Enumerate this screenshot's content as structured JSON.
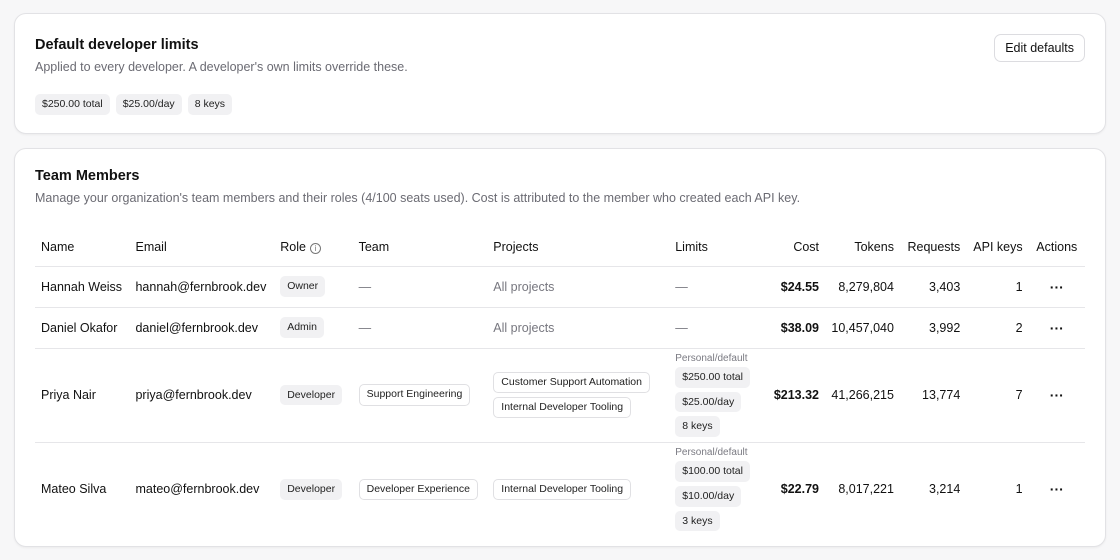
{
  "defaults": {
    "title": "Default developer limits",
    "description": "Applied to every developer. A developer's own limits override these.",
    "edit_label": "Edit defaults",
    "chips": [
      "$250.00 total",
      "$25.00/day",
      "8 keys"
    ]
  },
  "team": {
    "title": "Team Members",
    "description": "Manage your organization's team members and their roles (4/100 seats used). Cost is attributed to the member who created each API key.",
    "columns": {
      "name": "Name",
      "email": "Email",
      "role": "Role",
      "team": "Team",
      "projects": "Projects",
      "limits": "Limits",
      "cost": "Cost",
      "tokens": "Tokens",
      "requests": "Requests",
      "api_keys": "API keys",
      "actions": "Actions"
    },
    "members": [
      {
        "name": "Hannah Weiss",
        "email": "hannah@fernbrook.dev",
        "role": "Owner",
        "team": "—",
        "projects": "All projects",
        "limits": "—",
        "cost": "$24.55",
        "tokens": "8,279,804",
        "requests": "3,403",
        "api_keys": "1"
      },
      {
        "name": "Daniel Okafor",
        "email": "daniel@fernbrook.dev",
        "role": "Admin",
        "team": "—",
        "projects": "All projects",
        "limits": "—",
        "cost": "$38.09",
        "tokens": "10,457,040",
        "requests": "3,992",
        "api_keys": "2"
      },
      {
        "name": "Priya Nair",
        "email": "priya@fernbrook.dev",
        "role": "Developer",
        "team": "Support Engineering",
        "projects": [
          "Customer Support Automation",
          "Internal Developer Tooling"
        ],
        "limits_label": "Personal/default",
        "limits": [
          "$250.00 total",
          "$25.00/day",
          "8 keys"
        ],
        "cost": "$213.32",
        "tokens": "41,266,215",
        "requests": "13,774",
        "api_keys": "7"
      },
      {
        "name": "Mateo Silva",
        "email": "mateo@fernbrook.dev",
        "role": "Developer",
        "team": "Developer Experience",
        "projects": [
          "Internal Developer Tooling"
        ],
        "limits_label": "Personal/default",
        "limits": [
          "$100.00 total",
          "$10.00/day",
          "3 keys"
        ],
        "cost": "$22.79",
        "tokens": "8,017,221",
        "requests": "3,214",
        "api_keys": "1"
      }
    ],
    "actions_glyph": "···",
    "info_glyph": "i"
  }
}
